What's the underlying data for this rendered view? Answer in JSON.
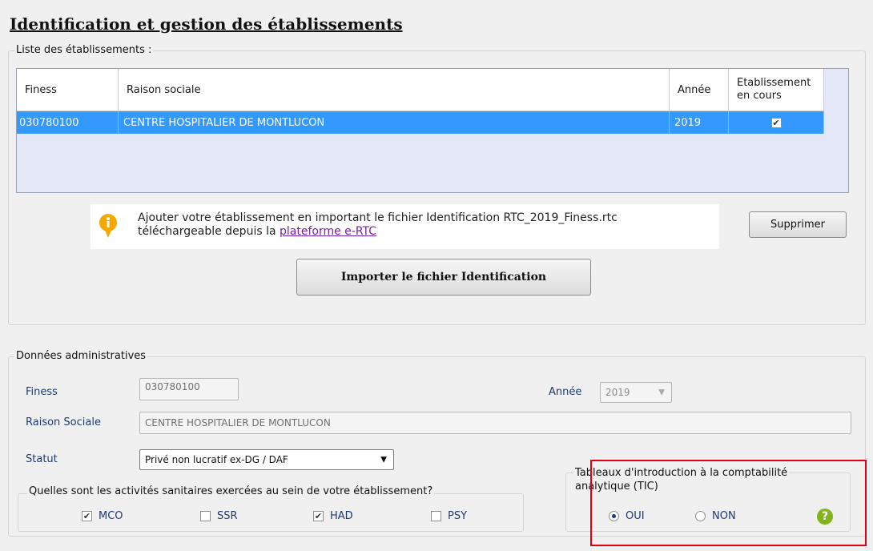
{
  "page": {
    "title": "Identification et gestion des établissements"
  },
  "list": {
    "legend": "Liste des établissements :",
    "columns": {
      "finess": "Finess",
      "raison": "Raison sociale",
      "annee": "Année",
      "encours_line1": "Etablissement",
      "encours_line2": "en cours"
    },
    "rows": [
      {
        "finess": "030780100",
        "raison": "CENTRE HOSPITALIER DE MONTLUCON",
        "annee": "2019",
        "en_cours": true
      }
    ]
  },
  "info": {
    "line1": "Ajouter votre établissement en important le fichier Identification RTC_2019_Finess.rtc",
    "line2_prefix": "téléchargeable depuis la ",
    "link_text": "plateforme e-RTC",
    "icon": "info-icon"
  },
  "buttons": {
    "supprimer": "Supprimer",
    "importer": "Importer le fichier Identification"
  },
  "admin": {
    "legend": "Données administratives",
    "finess_label": "Finess",
    "finess_value": "030780100",
    "annee_label": "Année",
    "annee_value": "2019",
    "raison_label": "Raison Sociale",
    "raison_value": "CENTRE HOSPITALIER DE MONTLUCON",
    "statut_label": "Statut",
    "statut_value": "Privé non lucratif ex-DG / DAF"
  },
  "activities": {
    "legend": "Quelles sont les activités sanitaires exercées au sein de votre établissement?",
    "items": [
      {
        "label": "MCO",
        "checked": true
      },
      {
        "label": "SSR",
        "checked": false
      },
      {
        "label": "HAD",
        "checked": true
      },
      {
        "label": "PSY",
        "checked": false
      }
    ]
  },
  "tic": {
    "legend_line1": "Tableaux d'introduction à la comptabilité",
    "legend_line2": "analytique (TIC)",
    "oui": "OUI",
    "non": "NON",
    "selected": "OUI"
  },
  "colors": {
    "selection": "#3399ff",
    "highlight_box": "#e0000f",
    "help_icon": "#82b41e",
    "info_icon": "#f5a800"
  }
}
